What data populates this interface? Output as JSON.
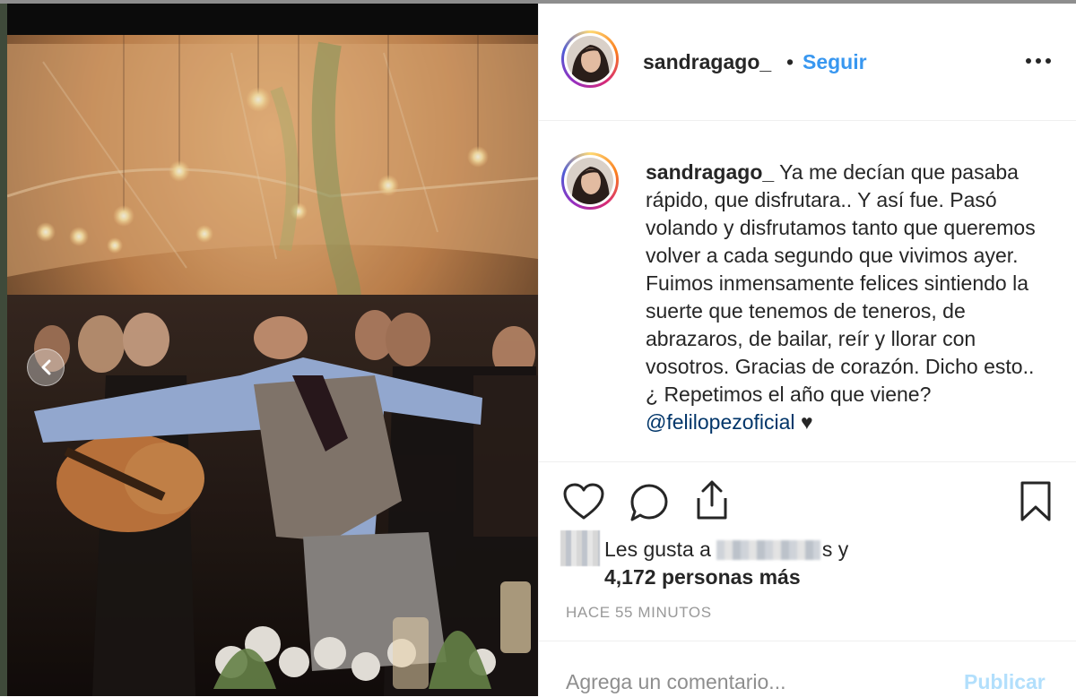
{
  "post": {
    "username": "sandragago_",
    "separator": "•",
    "follow_label": "Seguir",
    "more_icon": "more-options-icon"
  },
  "caption": {
    "username": "sandragago_",
    "text": "Ya me decían que pasaba rápido, que disfrutara.. Y así fue. Pasó volando y disfrutamos tanto que queremos volver a cada segundo que vivimos ayer. Fuimos inmensamente felices sintiendo la suerte que tenemos de teneros, de abrazaros, de bailar, reír y llorar con vosotros. Gracias de corazón. Dicho esto.. ¿ Repetimos el año que viene?",
    "mention": "@felilopezoficial",
    "heart": "♥"
  },
  "actions": {
    "icons": [
      "heart-icon",
      "comment-icon",
      "share-icon",
      "bookmark-icon"
    ]
  },
  "likes": {
    "prefix": "Les gusta a",
    "suffix": "s y",
    "count_text": "4,172 personas más"
  },
  "timestamp": "HACE 55 MINUTOS",
  "comment": {
    "placeholder": "Agrega un comentario...",
    "publish_label": "Publicar"
  },
  "colors": {
    "link_blue": "#3897f0",
    "mention_blue": "#003569",
    "publish_disabled": "#b2dffc",
    "muted": "#999999"
  }
}
